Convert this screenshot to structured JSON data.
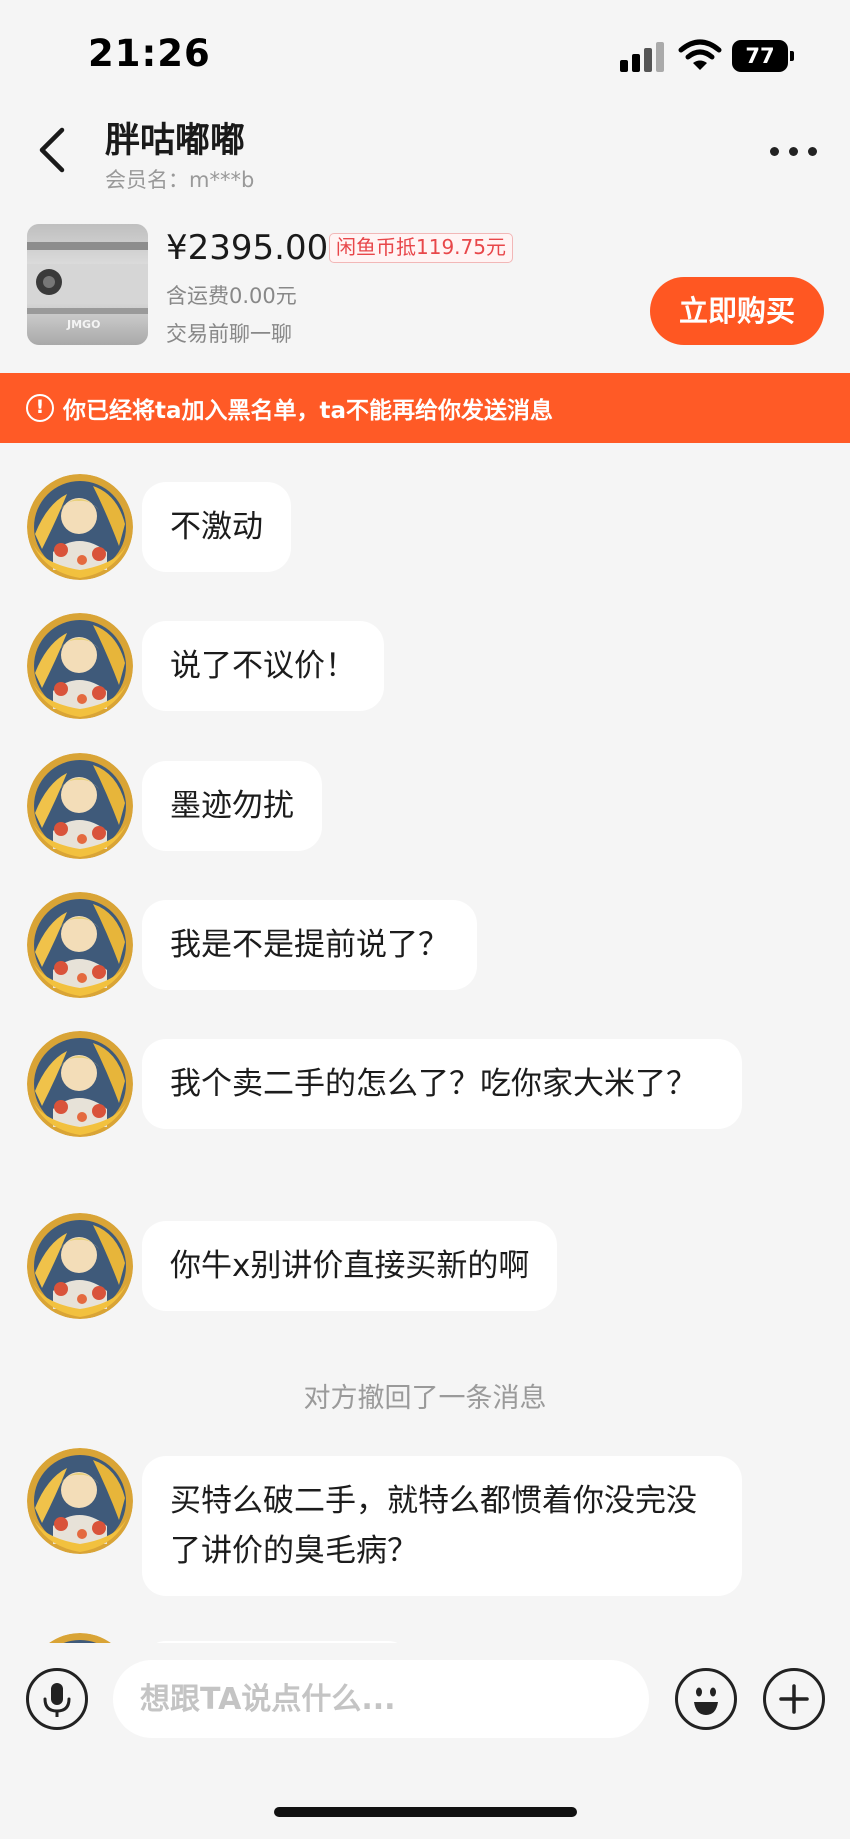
{
  "status_bar": {
    "time": "21:26",
    "battery": "77"
  },
  "header": {
    "title": "胖咕嘟嘟",
    "member_name": "会员名：m***b"
  },
  "product": {
    "price": "¥2395.00",
    "coin_deduct": "闲鱼币抵119.75元",
    "shipping": "含运费0.00元",
    "chat_hint": "交易前聊一聊",
    "buy_label": "立即购买",
    "thumb_brand": "JMGO"
  },
  "banner": {
    "icon": "!",
    "text": "你已经将ta加入黑名单，ta不能再给你发送消息"
  },
  "messages": [
    {
      "type": "incoming",
      "text": "不激动"
    },
    {
      "type": "incoming",
      "text": "说了不议价！"
    },
    {
      "type": "incoming",
      "text": "墨迹勿扰"
    },
    {
      "type": "incoming",
      "text": "我是不是提前说了？"
    },
    {
      "type": "incoming",
      "text": "我个卖二手的怎么了？吃你家大米了？"
    },
    {
      "type": "incoming",
      "text": "你牛x别讲价直接买新的啊"
    },
    {
      "type": "system",
      "text": "对方撤回了一条消息"
    },
    {
      "type": "incoming",
      "text": "买特么破二手，就特么都惯着你没完没了讲价的臭毛病？"
    }
  ],
  "input": {
    "placeholder": "想跟TA说点什么..."
  },
  "icons": {
    "back": "chevron-left-icon",
    "more": "more-dots-icon",
    "voice": "microphone-icon",
    "emoji": "emoji-icon",
    "add": "plus-icon",
    "warning": "alert-circle-icon"
  },
  "colors": {
    "accent": "#ff5722",
    "banner": "#ff5a26",
    "background": "#f5f5f5",
    "bubble": "#ffffff",
    "coin_tag": "#e8474a"
  }
}
